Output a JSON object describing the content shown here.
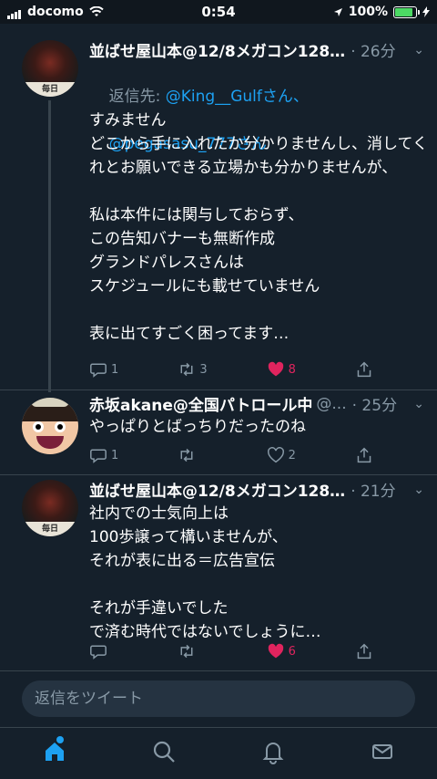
{
  "status_bar": {
    "carrier": "docomo",
    "time": "0:54",
    "battery": "100%",
    "battery_level": 1.0
  },
  "tweets": [
    {
      "name": "並ばせ屋山本@12/8メガコン128…",
      "handle": "",
      "time": "· 26分",
      "avatar_caption": "毎日",
      "reply_prefix": "返信先: ",
      "reply_mention1": "@King__Gulfさん、",
      "reply_mention2": "@pegasasu_777さん",
      "text": "すみません\nどこから手に入れたか分かりませんし、消してくれとお願いできる立場かも分かりませんが、\n\n私は本件には関与しておらず、\nこの告知バナーも無断作成\nグランドパレスさんは\nスケジュールにも載せていません\n\n表に出てすごく困ってます…",
      "reply_count": "1",
      "retweet_count": "3",
      "like_count": "8"
    },
    {
      "name": "赤坂akane@全国パトロール中",
      "handle": "@...",
      "time": "· 25分",
      "text": "やっぱりとばっちりだったのね",
      "reply_count": "1",
      "retweet_count": "",
      "like_count": "2"
    },
    {
      "name": "並ばせ屋山本@12/8メガコン128…",
      "handle": "",
      "time": "· 21分",
      "avatar_caption": "毎日",
      "text": "社内での士気向上は\n100歩譲って構いませんが、\nそれが表に出る＝広告宣伝\n\nそれが手違いでした\nで済む時代ではないでしょうに…",
      "reply_count": "",
      "retweet_count": "",
      "like_count": "6"
    }
  ],
  "compose": {
    "placeholder": "返信をツイート"
  },
  "tabs": [
    "home",
    "search",
    "notifications",
    "messages"
  ],
  "icons": {
    "wifi": "wifi-icon",
    "location": "location-arrow-icon",
    "charging": "bolt-icon",
    "reply": "reply-icon",
    "retweet": "retweet-icon",
    "like": "heart-icon",
    "share": "share-icon",
    "more": "chevron-down-icon"
  },
  "colors": {
    "background": "#15202b",
    "accent": "#1da1f2",
    "like": "#e0245e",
    "muted": "#8899a6"
  }
}
